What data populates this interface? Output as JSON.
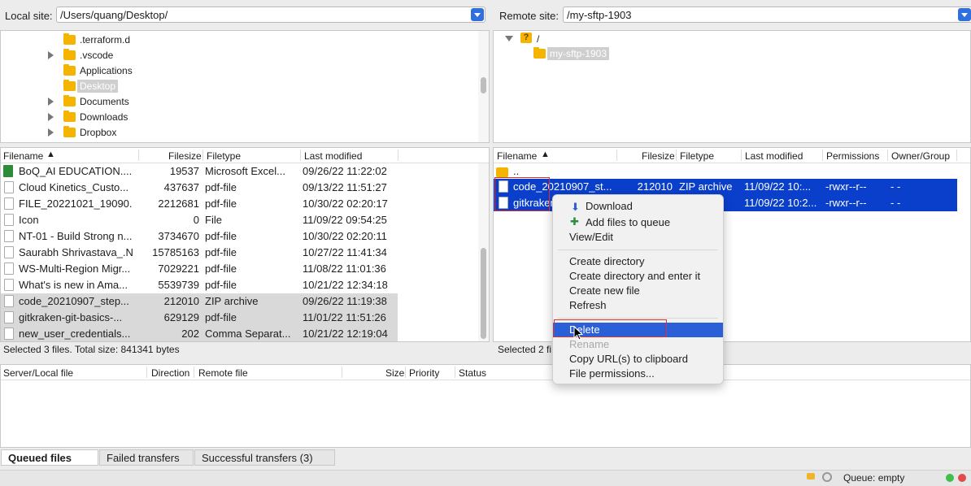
{
  "local": {
    "site_label": "Local site:",
    "site_path": "/Users/quang/Desktop/",
    "tree": [
      {
        "label": ".terraform.d",
        "expand": false
      },
      {
        "label": ".vscode",
        "expand": true
      },
      {
        "label": "Applications",
        "expand": false
      },
      {
        "label": "Desktop",
        "expand": false,
        "selected": true
      },
      {
        "label": "Documents",
        "expand": true
      },
      {
        "label": "Downloads",
        "expand": true
      },
      {
        "label": "Dropbox",
        "expand": true
      }
    ],
    "columns": [
      "Filename",
      "Filesize",
      "Filetype",
      "Last modified"
    ],
    "files": [
      {
        "name": "BoQ_AI EDUCATION....",
        "size": "19537",
        "type": "Microsoft Excel...",
        "modified": "09/26/22 11:22:02"
      },
      {
        "name": "Cloud Kinetics_Custo...",
        "size": "437637",
        "type": "pdf-file",
        "modified": "09/13/22 11:51:27"
      },
      {
        "name": "FILE_20221021_19090...",
        "size": "2212681",
        "type": "pdf-file",
        "modified": "10/30/22 02:20:17"
      },
      {
        "name": "Icon",
        "size": "0",
        "type": "File",
        "modified": "11/09/22 09:54:25"
      },
      {
        "name": "NT-01 - Build Strong n...",
        "size": "3734670",
        "type": "pdf-file",
        "modified": "10/30/22 02:20:11"
      },
      {
        "name": "Saurabh Shrivastava_.N...",
        "size": "15785163",
        "type": "pdf-file",
        "modified": "10/27/22 11:41:34"
      },
      {
        "name": "WS-Multi-Region Migr...",
        "size": "7029221",
        "type": "pdf-file",
        "modified": "11/08/22 11:01:36"
      },
      {
        "name": "What's is new in Ama...",
        "size": "5539739",
        "type": "pdf-file",
        "modified": "10/21/22 12:34:18"
      },
      {
        "name": "code_20210907_step...",
        "size": "212010",
        "type": "ZIP archive",
        "modified": "09/26/22 11:19:38"
      },
      {
        "name": "gitkraken-git-basics-...",
        "size": "629129",
        "type": "pdf-file",
        "modified": "11/01/22 11:51:26"
      },
      {
        "name": "new_user_credentials...",
        "size": "202",
        "type": "Comma Separat...",
        "modified": "10/21/22 12:19:04"
      }
    ],
    "status": "Selected 3 files. Total size: 841341 bytes"
  },
  "remote": {
    "site_label": "Remote site:",
    "site_path": "/my-sftp-1903",
    "tree_root": "/",
    "tree_root_icon": "?",
    "tree_child": "my-sftp-1903",
    "columns": [
      "Filename",
      "Filesize",
      "Filetype",
      "Last modified",
      "Permissions",
      "Owner/Group"
    ],
    "parent_dir": "..",
    "files": [
      {
        "name": "code_20210907_st...",
        "size": "212010",
        "type": "ZIP archive",
        "modified": "11/09/22 10:...",
        "perms": "-rwxr--r--",
        "owner": "- -"
      },
      {
        "name": "gitkraken",
        "size": "",
        "type": "",
        "modified": "11/09/22 10:2...",
        "perms": "-rwxr--r--",
        "owner": "- -"
      }
    ],
    "status": "Selected 2 fi"
  },
  "queue": {
    "columns": [
      "Server/Local file",
      "Direction",
      "Remote file",
      "Size",
      "Priority",
      "Status"
    ]
  },
  "tabs": [
    "Queued files",
    "Failed transfers",
    "Successful transfers (3)"
  ],
  "footer": {
    "queue_status": "Queue: empty"
  },
  "context_menu": {
    "download": "Download",
    "add_to_queue": "Add files to queue",
    "view_edit": "View/Edit",
    "create_dir": "Create directory",
    "create_dir_enter": "Create directory and enter it",
    "create_file": "Create new file",
    "refresh": "Refresh",
    "delete": "Delete",
    "rename": "Rename",
    "copy_url": "Copy URL(s) to clipboard",
    "file_permissions": "File permissions..."
  }
}
